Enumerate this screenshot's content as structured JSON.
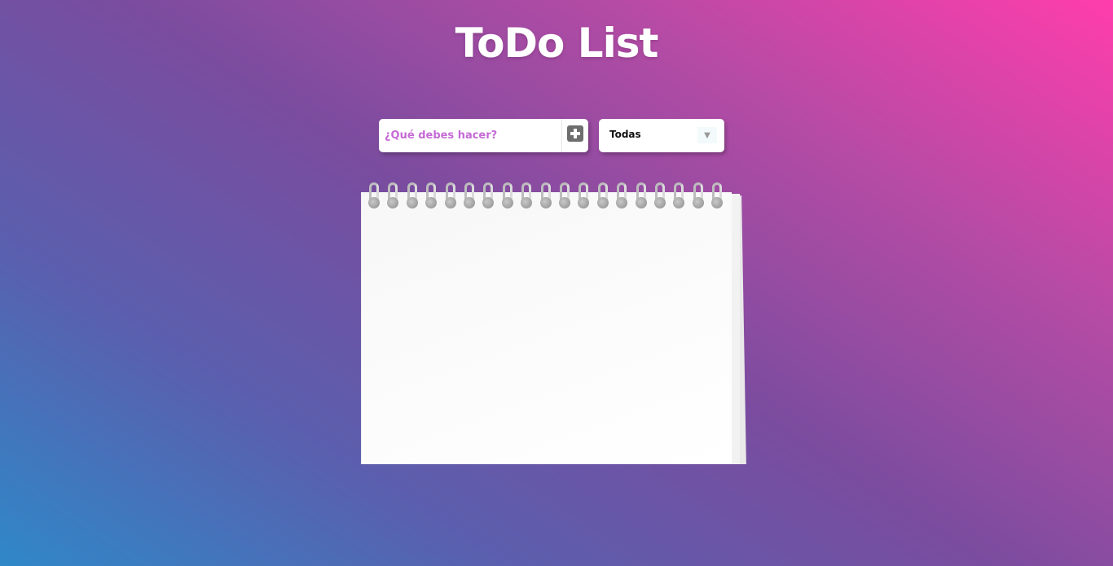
{
  "app": {
    "title": "ToDo List"
  },
  "form": {
    "task_input": {
      "placeholder": "¿Qué debes hacer?",
      "value": ""
    },
    "add_button_icon": "plus-icon"
  },
  "filter": {
    "selected": "Todas",
    "arrow_icon": "chevron-down-icon"
  },
  "todo_list": {
    "items": []
  },
  "colors": {
    "background_gradient_start": "#2f88c8",
    "background_gradient_end": "#ff3dac",
    "placeholder_color": "#c56ad6",
    "title_color": "#ffffff"
  }
}
